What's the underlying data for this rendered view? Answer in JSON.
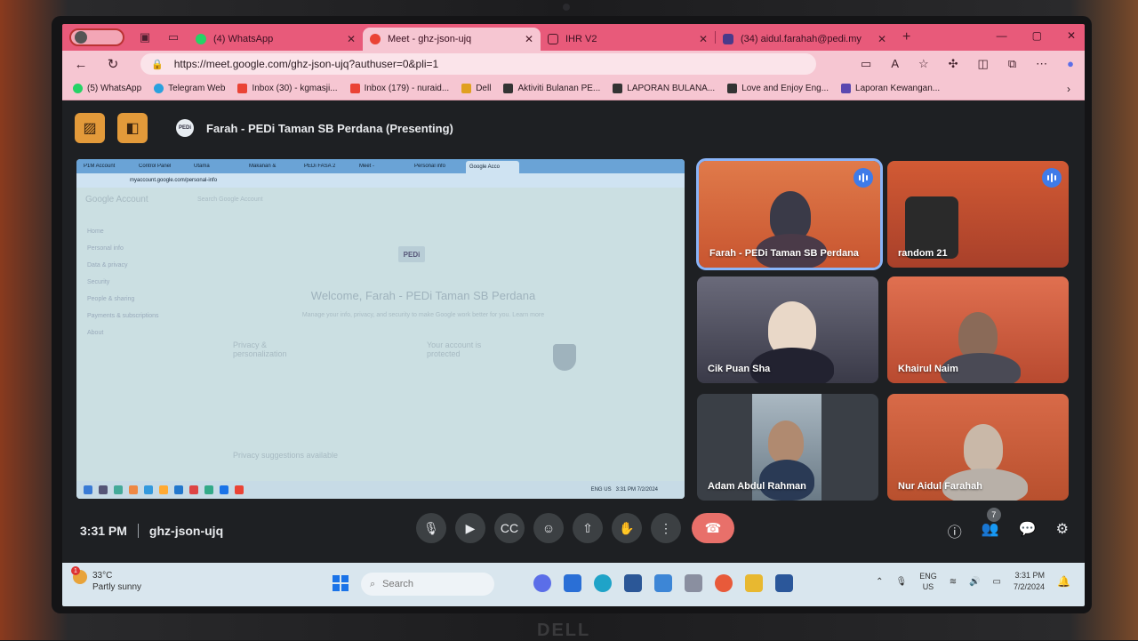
{
  "browser": {
    "tabs": [
      {
        "label": "(4) WhatsApp",
        "favicon_color": "#25d366",
        "active": false
      },
      {
        "label": "Meet - ghz-json-ujq",
        "favicon_color": "#ea4335",
        "active": true
      },
      {
        "label": "IHR V2",
        "favicon_color": "#ffffff",
        "active": false
      },
      {
        "label": "(34) aidul.farahah@pedi.my",
        "favicon_color": "#4a3a8a",
        "active": false
      }
    ],
    "url": "https://meet.google.com/ghz-json-ujq?authuser=0&pli=1",
    "bookmarks": [
      {
        "label": "(5) WhatsApp",
        "color": "#25d366"
      },
      {
        "label": "Telegram Web",
        "color": "#2aa1de"
      },
      {
        "label": "Inbox (30) - kgmasji...",
        "color": "#ea4335"
      },
      {
        "label": "Inbox (179) - nuraid...",
        "color": "#ea4335"
      },
      {
        "label": "Dell",
        "color": "#e0a020"
      },
      {
        "label": "Aktiviti Bulanan PE...",
        "color": "#333333"
      },
      {
        "label": "LAPORAN BULANA...",
        "color": "#333333"
      },
      {
        "label": "Love and Enjoy Eng...",
        "color": "#333333"
      },
      {
        "label": "Laporan Kewangan...",
        "color": "#5a48b0"
      }
    ]
  },
  "meet": {
    "presenter_title": "Farah - PEDi Taman SB Perdana (Presenting)",
    "presenter_badge": "PEDi",
    "shared_screen": {
      "tabs": [
        "P1M Account",
        "Control Panel",
        "Utama",
        "Makanan &",
        "PEDi FASA 2",
        "Meet -",
        "Personal info",
        "Google Acco"
      ],
      "url": "myaccount.google.com/personal-info",
      "app_name": "Google Account",
      "search_placeholder": "Search Google Account",
      "sidebar": [
        "Home",
        "Personal info",
        "Data & privacy",
        "Security",
        "People & sharing",
        "Payments & subscriptions",
        "About"
      ],
      "logo": "PEDi",
      "welcome": "Welcome, Farah - PEDi Taman SB Perdana",
      "subtitle": "Manage your info, privacy, and security to make Google work better for you. Learn more",
      "card1_title": "Privacy & personalization",
      "card2_title": "Your account is protected",
      "suggestions": "Privacy suggestions available",
      "lang": "ENG US",
      "clock": "3:31 PM 7/2/2024"
    },
    "participants": [
      {
        "name": "Farah - PEDi Taman SB Perdana",
        "speaking": true,
        "active": true,
        "bg": "#d9633a",
        "person": "#3a3a48"
      },
      {
        "name": "random 21",
        "speaking": true,
        "active": false,
        "bg": "#c4502e",
        "person": "#2a2a2a"
      },
      {
        "name": "Cik Puan Sha",
        "speaking": false,
        "active": false,
        "bg": "#5a5a6a",
        "person": "#222230"
      },
      {
        "name": "Khairul Naim",
        "speaking": false,
        "active": false,
        "bg": "#d66a48",
        "person": "#4a4a55"
      },
      {
        "name": "Adam Abdul Rahman",
        "speaking": false,
        "active": false,
        "bg": "#3a3f46",
        "person": "#2a3a55"
      },
      {
        "name": "Nur Aidul Farahah",
        "speaking": false,
        "active": false,
        "bg": "#d06040",
        "person": "#b8b0a8"
      }
    ],
    "time": "3:31 PM",
    "meeting_code": "ghz-json-ujq",
    "people_count": "7"
  },
  "taskbar": {
    "temperature": "33°C",
    "weather": "Partly sunny",
    "weather_alert": "1",
    "search_placeholder": "Search",
    "lang_line1": "ENG",
    "lang_line2": "US",
    "time": "3:31 PM",
    "date": "7/2/2024"
  },
  "brand": "DELL"
}
